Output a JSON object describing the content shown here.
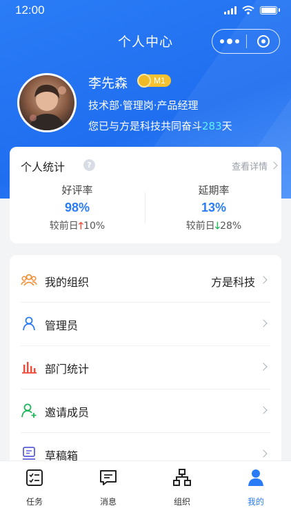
{
  "status_bar": {
    "time": "12:00"
  },
  "header": {
    "title": "个人中心"
  },
  "profile": {
    "name": "李先森",
    "level": "M1",
    "role": "技术部·管理岗·产品经理",
    "days_prefix": "您已与方是科技共同奋斗",
    "days_count": "283",
    "days_suffix": "天"
  },
  "stats": {
    "title": "个人统计",
    "help": "?",
    "detail_link": "查看详情",
    "items": [
      {
        "label": "好评率",
        "value": "98%",
        "compare_prefix": "较前日",
        "direction": "up",
        "change": "10%"
      },
      {
        "label": "延期率",
        "value": "13%",
        "compare_prefix": "较前日",
        "direction": "down",
        "change": "28%"
      }
    ]
  },
  "menu": {
    "items": [
      {
        "icon": "organization-icon",
        "label": "我的组织",
        "value": "方是科技"
      },
      {
        "icon": "admin-user-icon",
        "label": "管理员",
        "value": ""
      },
      {
        "icon": "bar-chart-icon",
        "label": "部门统计",
        "value": ""
      },
      {
        "icon": "add-user-icon",
        "label": "邀请成员",
        "value": ""
      },
      {
        "icon": "draft-box-icon",
        "label": "草稿箱",
        "value": ""
      }
    ]
  },
  "tabbar": {
    "items": [
      {
        "icon": "task-list-icon",
        "label": "任务"
      },
      {
        "icon": "message-icon",
        "label": "消息"
      },
      {
        "icon": "org-chart-icon",
        "label": "组织"
      },
      {
        "icon": "profile-icon",
        "label": "我的"
      }
    ],
    "active": "我的"
  },
  "colors": {
    "primary": "#2a7cf6",
    "header_gradient_start": "#2b7cf6",
    "accent_days": "#5ef0ff",
    "up": "#f04a3a",
    "down": "#1fb55a",
    "badge": "#f4c230"
  }
}
